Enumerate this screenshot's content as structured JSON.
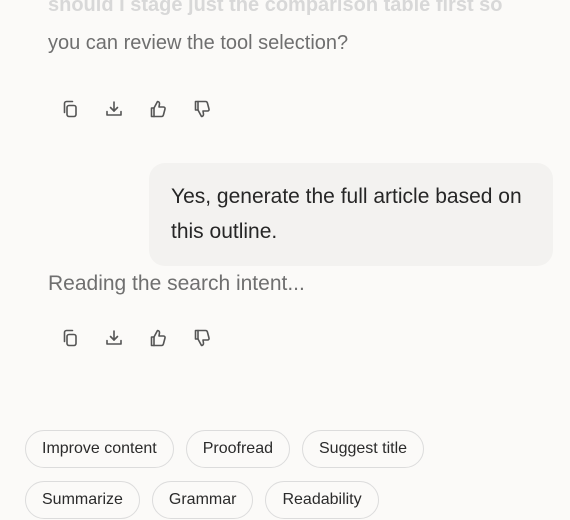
{
  "conversation": {
    "assistant_previous": {
      "faded_line": "should I stage just the comparison table first so",
      "line": "you can review the tool selection?"
    },
    "user_message": "Yes, generate the full article based on this outline.",
    "assistant_status": "Reading the search intent..."
  },
  "message_actions": {
    "icons": [
      "copy-icon",
      "download-icon",
      "thumbs-up-icon",
      "thumbs-down-icon"
    ]
  },
  "suggestions": {
    "row1": [
      "Improve content",
      "Proofread",
      "Suggest title"
    ],
    "row2": [
      "Summarize",
      "Grammar",
      "Readability"
    ]
  },
  "colors": {
    "background": "#fbfaf8",
    "user_bubble": "#f3f2f0",
    "muted_text": "#6f6f6f",
    "chip_border": "#dcdcdc"
  }
}
